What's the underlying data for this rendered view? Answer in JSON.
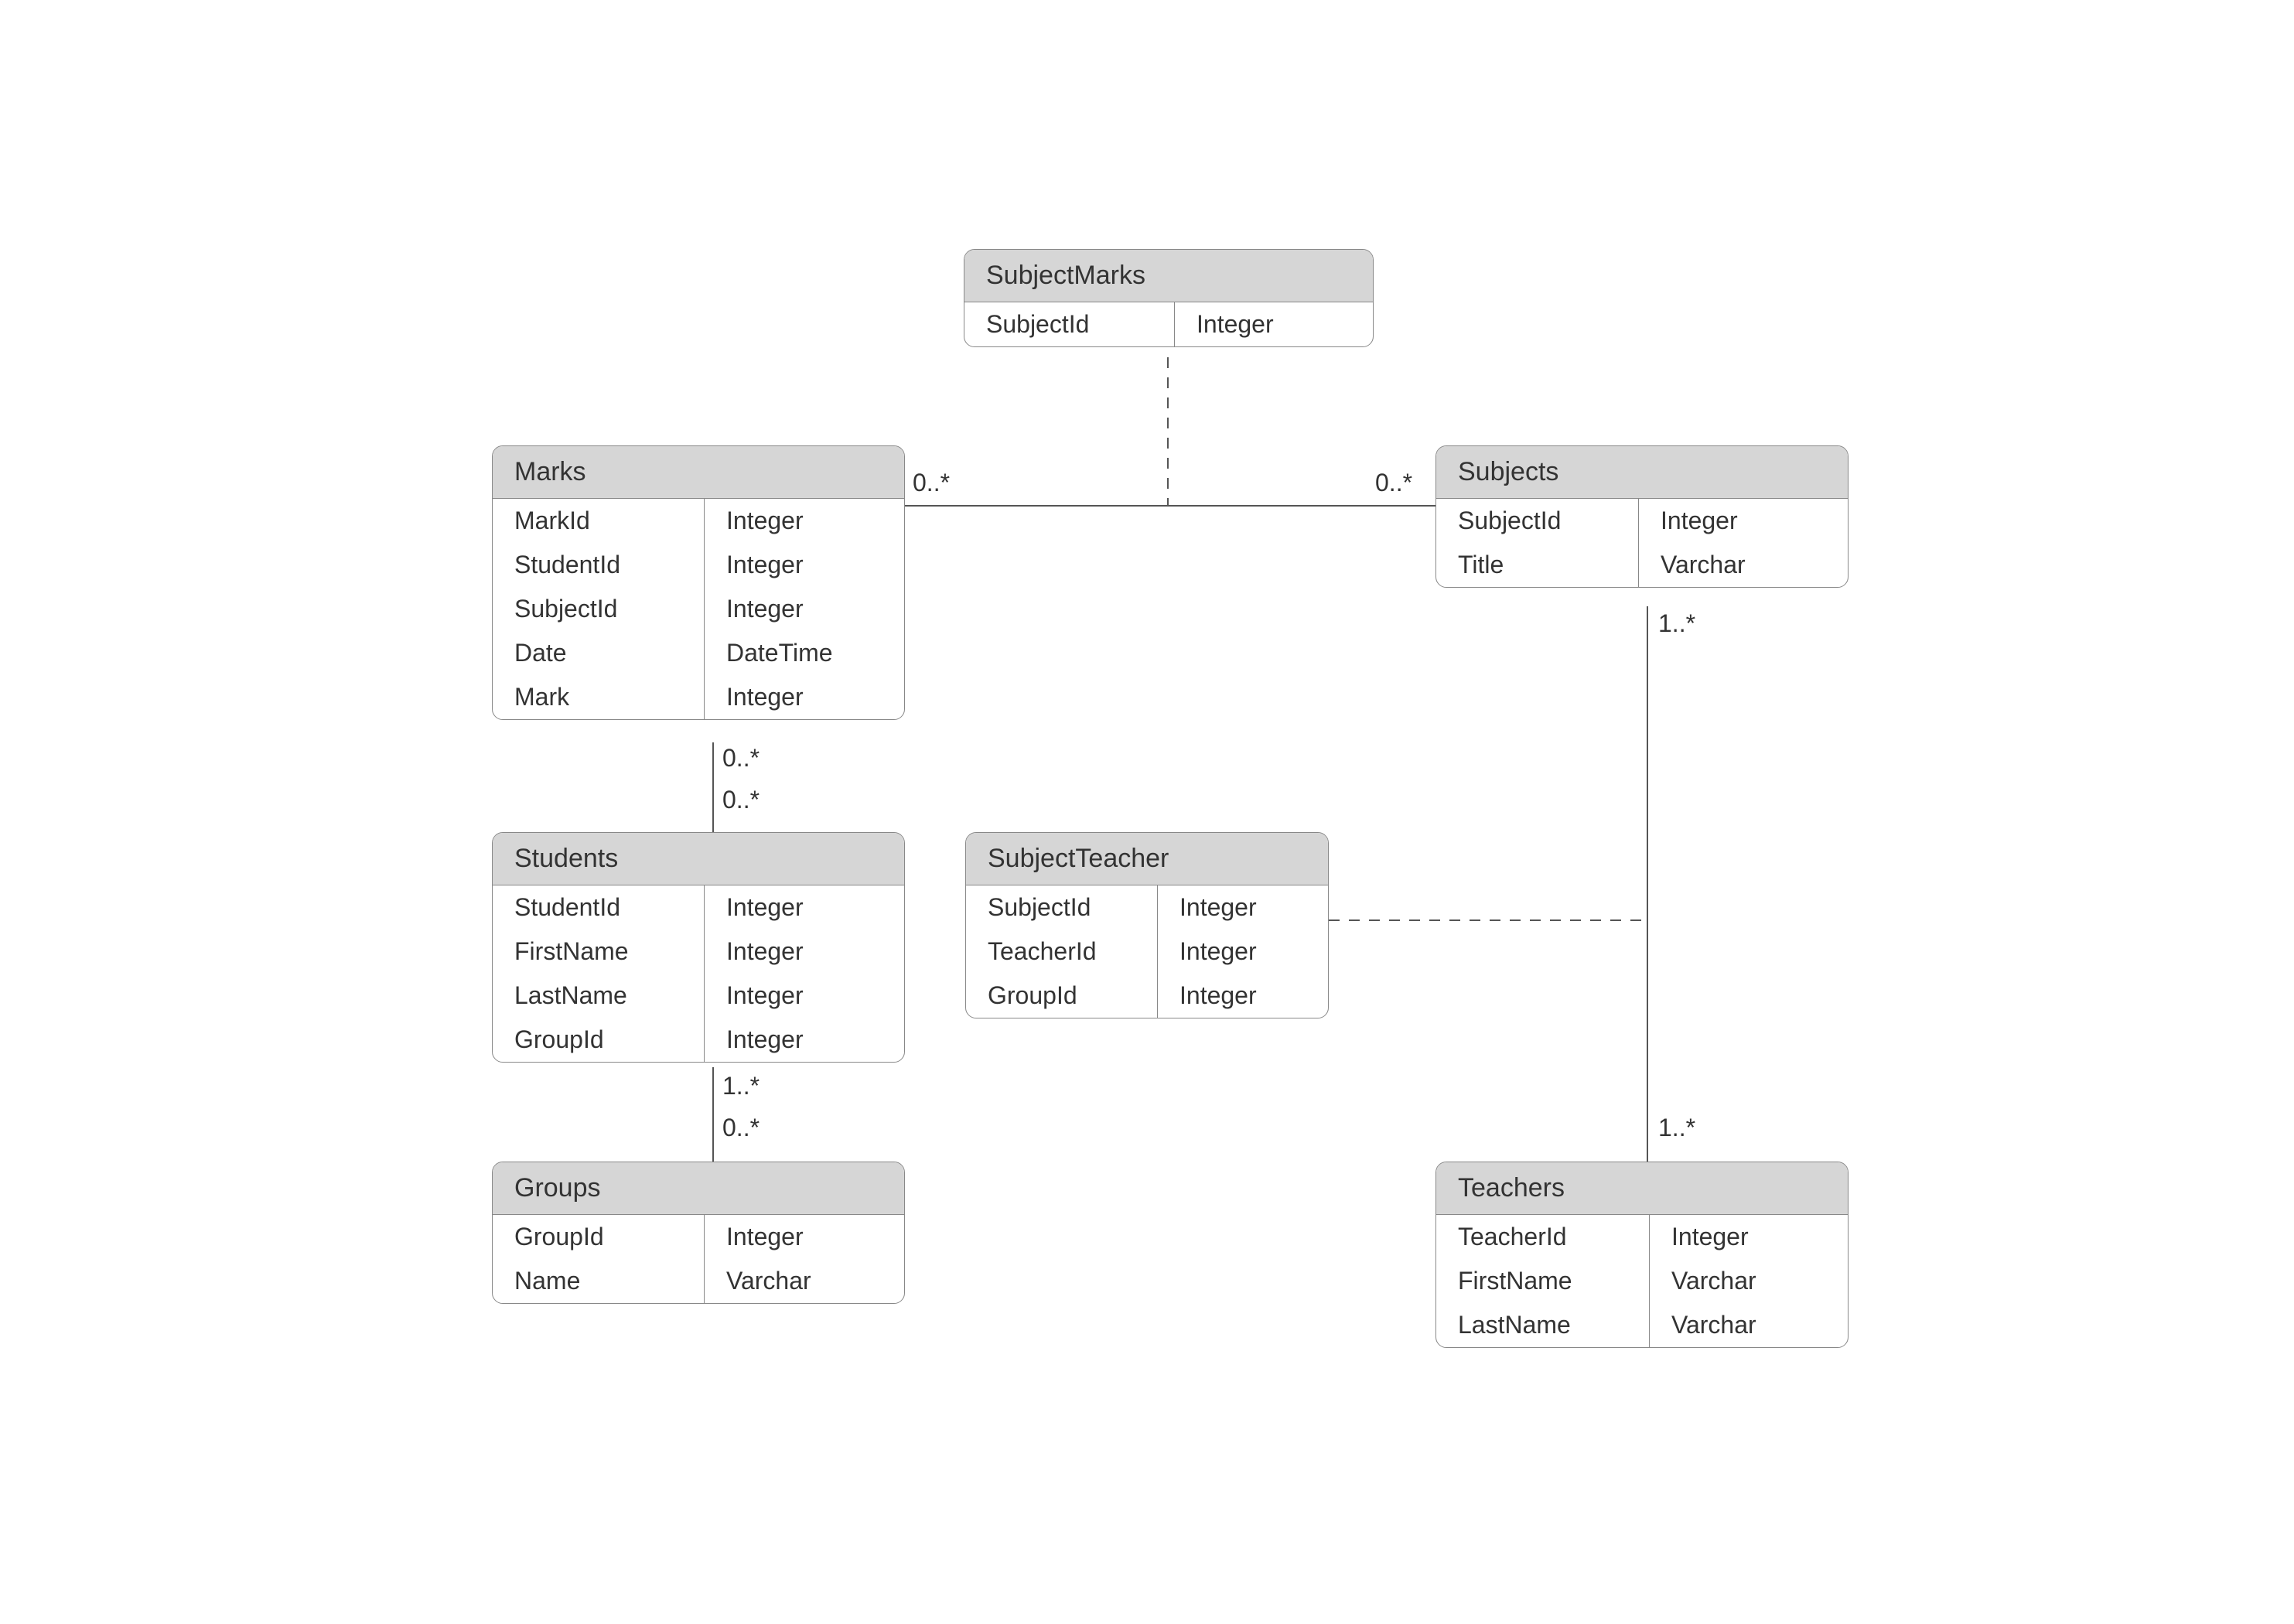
{
  "entities": {
    "subjectMarks": {
      "title": "SubjectMarks",
      "rows": [
        {
          "name": "SubjectId",
          "type": "Integer"
        }
      ]
    },
    "marks": {
      "title": "Marks",
      "rows": [
        {
          "name": "MarkId",
          "type": "Integer"
        },
        {
          "name": "StudentId",
          "type": "Integer"
        },
        {
          "name": "SubjectId",
          "type": "Integer"
        },
        {
          "name": "Date",
          "type": "DateTime"
        },
        {
          "name": "Mark",
          "type": "Integer"
        }
      ]
    },
    "subjects": {
      "title": "Subjects",
      "rows": [
        {
          "name": "SubjectId",
          "type": "Integer"
        },
        {
          "name": "Title",
          "type": "Varchar"
        }
      ]
    },
    "students": {
      "title": "Students",
      "rows": [
        {
          "name": "StudentId",
          "type": "Integer"
        },
        {
          "name": "FirstName",
          "type": "Integer"
        },
        {
          "name": "LastName",
          "type": "Integer"
        },
        {
          "name": "GroupId",
          "type": "Integer"
        }
      ]
    },
    "subjectTeacher": {
      "title": "SubjectTeacher",
      "rows": [
        {
          "name": "SubjectId",
          "type": "Integer"
        },
        {
          "name": "TeacherId",
          "type": "Integer"
        },
        {
          "name": "GroupId",
          "type": "Integer"
        }
      ]
    },
    "groups": {
      "title": "Groups",
      "rows": [
        {
          "name": "GroupId",
          "type": "Integer"
        },
        {
          "name": "Name",
          "type": "Varchar"
        }
      ]
    },
    "teachers": {
      "title": "Teachers",
      "rows": [
        {
          "name": "TeacherId",
          "type": "Integer"
        },
        {
          "name": "FirstName",
          "type": "Varchar"
        },
        {
          "name": "LastName",
          "type": "Varchar"
        }
      ]
    }
  },
  "multiplicities": {
    "marksSubjects_left": "0..*",
    "marksSubjects_right": "0..*",
    "marks_students_top": "0..*",
    "marks_students_bottom": "0..*",
    "students_groups_top": "1..*",
    "students_groups_bottom": "0..*",
    "subjects_teachers_top": "1..*",
    "subjects_teachers_bottom": "1..*"
  }
}
